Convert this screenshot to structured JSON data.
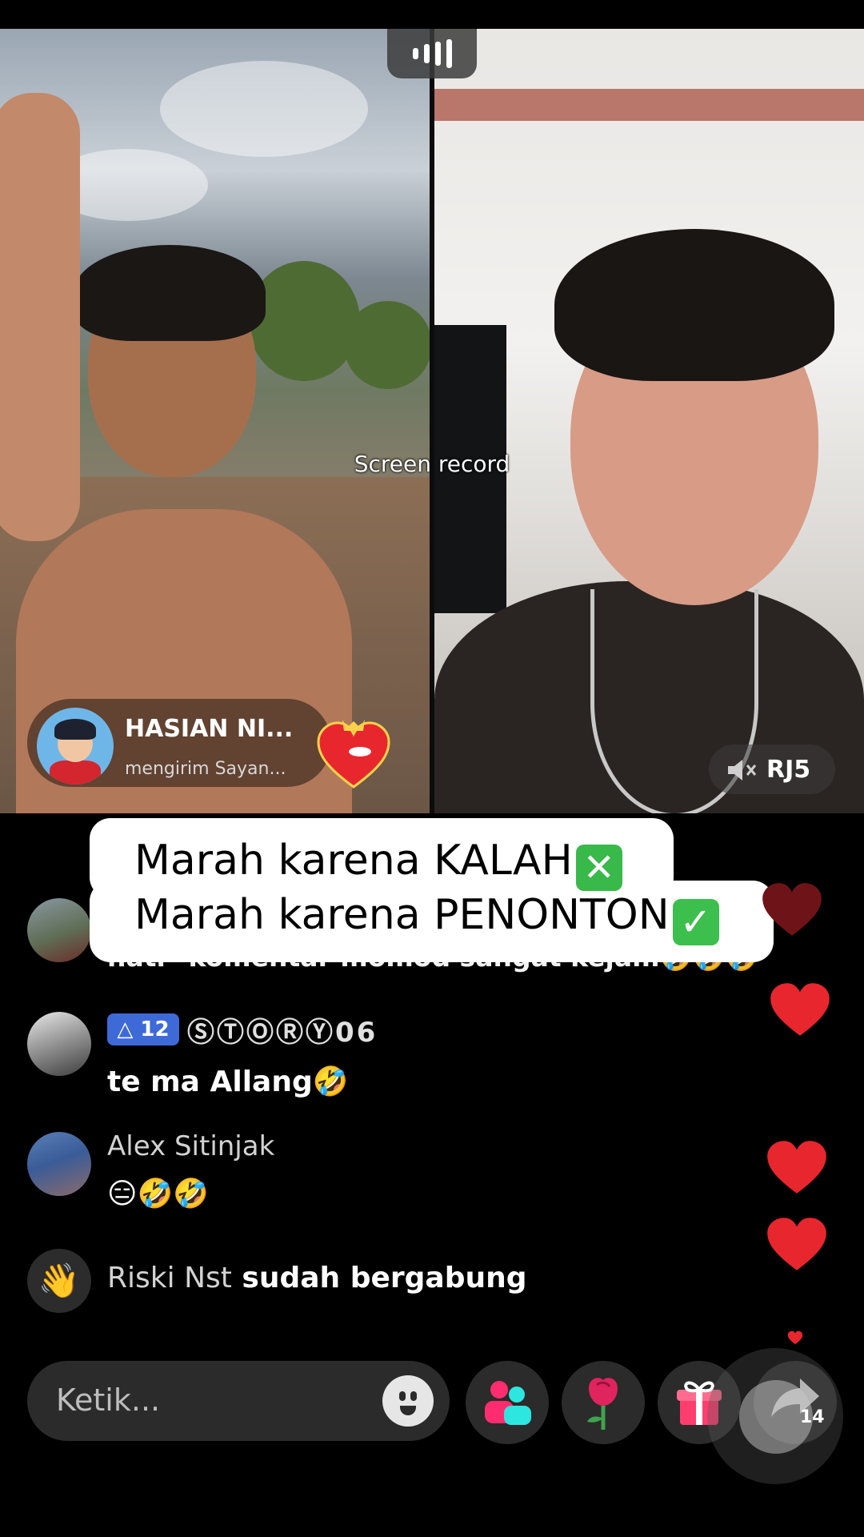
{
  "overlay": {
    "screen_record_label": "Screen record"
  },
  "left_stream": {
    "gift_notification": {
      "username": "HASIAN NI...",
      "message": "mengirim Sayan..."
    }
  },
  "right_stream": {
    "mute_label": "RJ5"
  },
  "caption": {
    "line1": "Marah karena KALAH",
    "line1_emoji": "✕",
    "line2": "Marah karena PENONTON",
    "line2_emoji": "✓"
  },
  "comments": [
    {
      "text": "hati\" komentar momod sangat kejam🤣🤣🤣"
    },
    {
      "badge_level": "12",
      "username": "ⓈⓉⓄⓇⓎ06",
      "text": "te ma Allang🤣"
    },
    {
      "username": "Alex Sitinjak",
      "text": "😑🤣🤣"
    },
    {
      "join_name": "Riski Nst",
      "join_text": " sudah bergabung"
    }
  ],
  "bottom_bar": {
    "input_placeholder": "Ketik...",
    "share_count": "14"
  },
  "colors": {
    "heart": "#e8262e",
    "badge": "#3e6ad8",
    "check_green": "#3cbf4c"
  }
}
